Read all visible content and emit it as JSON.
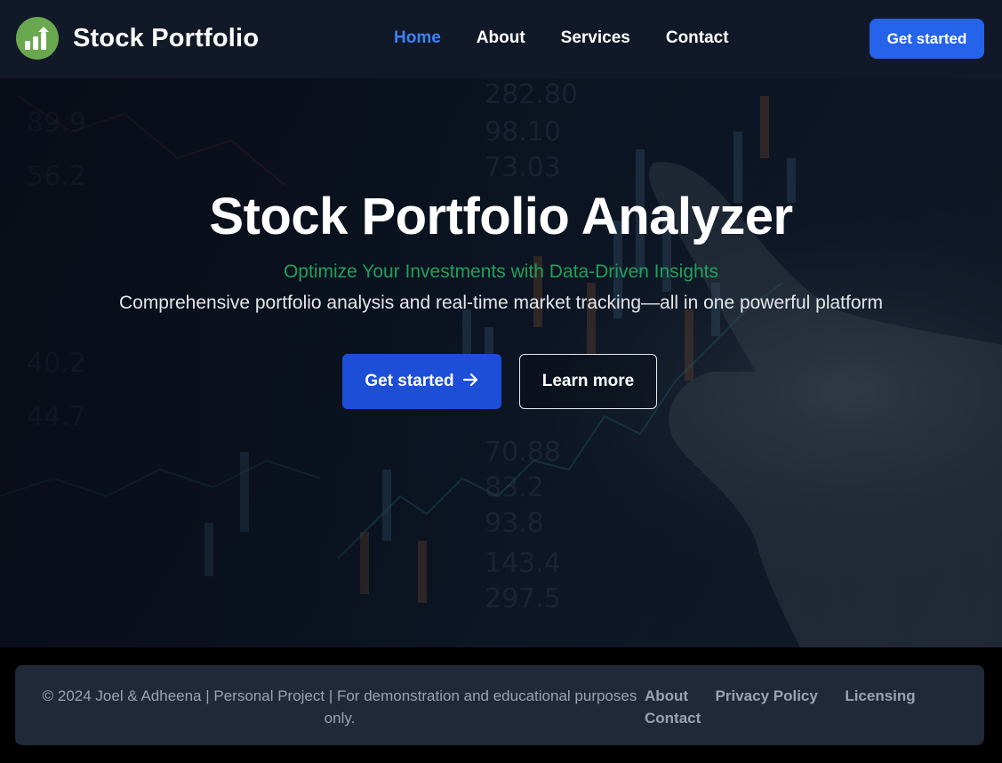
{
  "navbar": {
    "brand": "Stock Portfolio",
    "links": [
      {
        "label": "Home",
        "active": true
      },
      {
        "label": "About"
      },
      {
        "label": "Services"
      },
      {
        "label": "Contact"
      }
    ],
    "cta": "Get started"
  },
  "hero": {
    "title": "Stock Portfolio Analyzer",
    "subtitle": "Optimize Your Investments with Data-Driven Insights",
    "description": "Comprehensive portfolio analysis and real-time market tracking—all in one powerful platform",
    "primary_button": "Get started",
    "secondary_button": "Learn more"
  },
  "footer": {
    "copyright": "© 2024 Joel & Adheena | Personal Project | For demonstration and educational purposes only.",
    "links": [
      "About",
      "Privacy Policy",
      "Licensing",
      "Contact"
    ]
  },
  "colors": {
    "accent": "#2563eb",
    "active_nav": "#3b82f6",
    "subtitle_green": "#22a05a",
    "navbar_bg": "#111827",
    "footer_bg": "#1f2937"
  }
}
